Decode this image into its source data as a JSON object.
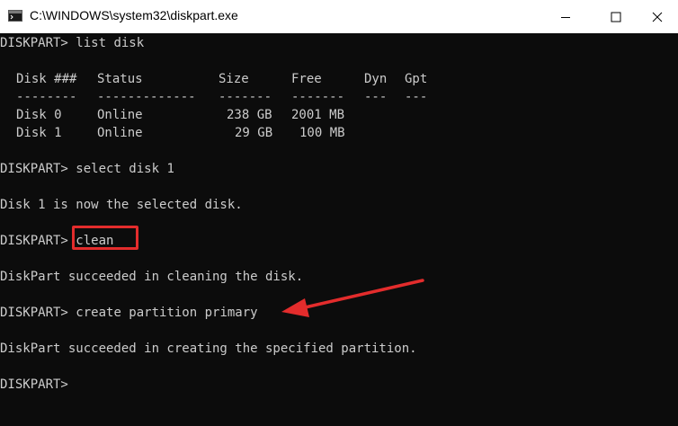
{
  "window": {
    "title": "C:\\WINDOWS\\system32\\diskpart.exe"
  },
  "console": {
    "prompt": "DISKPART>",
    "cmd_list_disk": "list disk",
    "table": {
      "headers": [
        "Disk ###",
        "Status",
        "Size",
        "Free",
        "Dyn",
        "Gpt"
      ],
      "separators": [
        "--------",
        "-------------",
        "-------",
        "-------",
        "---",
        "---"
      ],
      "rows": [
        [
          "Disk 0",
          "Online",
          "238 GB",
          "2001 MB",
          "",
          ""
        ],
        [
          "Disk 1",
          "Online",
          "29 GB",
          "100 MB",
          "",
          ""
        ]
      ]
    },
    "cmd_select_disk": "select disk 1",
    "msg_selected": "Disk 1 is now the selected disk.",
    "cmd_clean": "clean",
    "msg_cleaned": "DiskPart succeeded in cleaning the disk.",
    "cmd_create_partition": "create partition primary",
    "msg_created": "DiskPart succeeded in creating the specified partition."
  },
  "colors": {
    "background": "#0c0c0c",
    "text": "#cccccc",
    "annotation": "#e32c2c"
  },
  "icons": [
    "console-app-icon",
    "minimize-icon",
    "maximize-icon",
    "close-icon",
    "red-arrow-icon"
  ]
}
